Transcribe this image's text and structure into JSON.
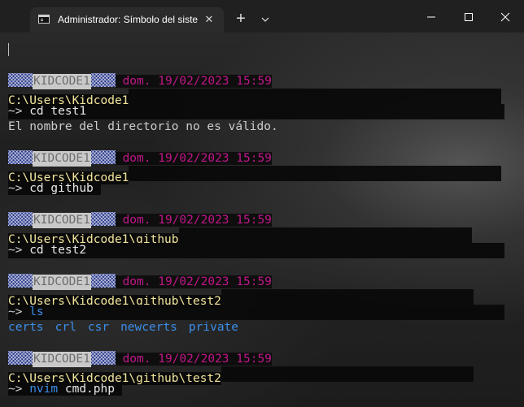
{
  "window": {
    "tab_title": "Administrador: Símbolo del sistema",
    "tab_close": "✕",
    "new_tab": "+"
  },
  "terminal": {
    "blocks": [
      {
        "host": "KIDCODE1",
        "datetime": "dom. 19/02/2023 15:59",
        "path": "C:\\Users\\Kidcode1",
        "prompt": "~>",
        "command_exec": "cd",
        "command_args": " test1",
        "output": "El nombre del directorio no es válido."
      },
      {
        "host": "KIDCODE1",
        "datetime": "dom. 19/02/2023 15:59",
        "path": "C:\\Users\\Kidcode1",
        "prompt": "~>",
        "command_exec": "cd",
        "command_args": " github"
      },
      {
        "host": "KIDCODE1",
        "datetime": "dom. 19/02/2023 15:59",
        "path": "C:\\Users\\Kidcode1\\github",
        "prompt": "~>",
        "command_exec": "cd",
        "command_args": " test2"
      },
      {
        "host": "KIDCODE1",
        "datetime": "dom. 19/02/2023 15:59",
        "path": "C:\\Users\\Kidcode1\\github\\test2",
        "prompt": "~>",
        "command_exec": "ls",
        "command_args": "",
        "ls_output": [
          "certs",
          "crl",
          "csr",
          "newcerts",
          "private"
        ]
      },
      {
        "host": "KIDCODE1",
        "datetime": "dom. 19/02/2023 15:59",
        "path": "C:\\Users\\Kidcode1\\github\\test2",
        "prompt": "~>",
        "command_exec": "nvim",
        "command_args": " cmd.php"
      }
    ]
  },
  "colors": {
    "date": "#c0178a",
    "path": "#f2e59c",
    "exec_command": "#3b8eea",
    "ls_entries": "#3b8eea",
    "titlebar": "#202020"
  },
  "icons": {
    "tab": "terminal-icon",
    "close": "close-icon",
    "new_tab": "plus-icon",
    "dropdown": "chevron-down-icon",
    "minimize": "minimize-icon",
    "maximize": "maximize-icon",
    "window_close": "window-close-icon"
  }
}
